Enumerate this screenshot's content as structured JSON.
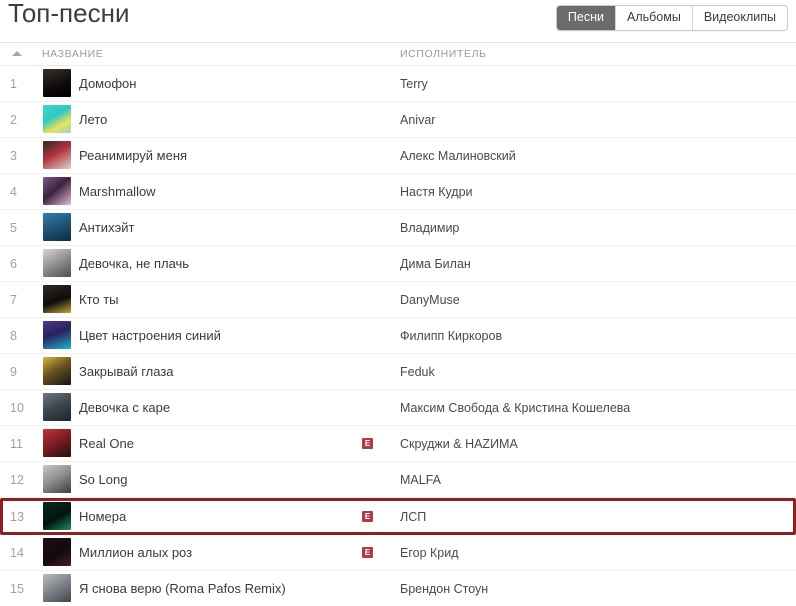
{
  "header": {
    "title": "Топ-песни",
    "tabs": [
      {
        "label": "Песни",
        "active": true
      },
      {
        "label": "Альбомы",
        "active": false
      },
      {
        "label": "Видеоклипы",
        "active": false
      }
    ]
  },
  "columns": {
    "sort_icon": "sort-ascending-triangle",
    "title": "НАЗВАНИЕ",
    "artist": "ИСПОЛНИТЕЛЬ"
  },
  "colors": {
    "accent_active_tab": "#6b6b6b",
    "explicit_badge": "#b23b4b",
    "highlight_border": "#8e2020",
    "title_text": "#3d3d3d",
    "muted_text": "#9a9a9a"
  },
  "explicit_badge_label": "E",
  "tracks": [
    {
      "rank": "1",
      "title": "Домофон",
      "artist": "Terry",
      "explicit": false,
      "highlighted": false,
      "art": "linear-gradient(160deg,#3a2e24 0%,#0d0b0a 60%,#000 100%)"
    },
    {
      "rank": "2",
      "title": "Лето",
      "artist": "Anivar",
      "explicit": false,
      "highlighted": false,
      "art": "linear-gradient(150deg,#3ad7d0 0%,#2fc9c2 40%,#e8e35c 70%,#9ad3cf 100%)"
    },
    {
      "rank": "3",
      "title": "Реанимируй меня",
      "artist": "Алекс Малиновский",
      "explicit": false,
      "highlighted": false,
      "art": "linear-gradient(150deg,#2a2a2a 0%,#b4323a 45%,#d9d6d2 100%)"
    },
    {
      "rank": "4",
      "title": "Marshmallow",
      "artist": "Настя Кудри",
      "explicit": false,
      "highlighted": false,
      "art": "linear-gradient(140deg,#7c5a86 0%,#3b2440 45%,#e8b9d4 100%)"
    },
    {
      "rank": "5",
      "title": "Антихэйт",
      "artist": "Владимир",
      "explicit": false,
      "highlighted": false,
      "art": "linear-gradient(160deg,#2e7fae 0%,#1d4f70 55%,#0f2c42 100%)"
    },
    {
      "rank": "6",
      "title": "Девочка, не плачь",
      "artist": "Дима Билан",
      "explicit": false,
      "highlighted": false,
      "art": "linear-gradient(150deg,#d6d6d6 0%,#8f8f90 50%,#4a4a52 100%)"
    },
    {
      "rank": "7",
      "title": "Кто ты",
      "artist": "DanyMuse",
      "explicit": false,
      "highlighted": false,
      "art": "linear-gradient(160deg,#2b2a26 0%,#0e0d0c 55%,#c8a23a 100%)"
    },
    {
      "rank": "8",
      "title": "Цвет настроения синий",
      "artist": "Филипп Киркоров",
      "explicit": false,
      "highlighted": false,
      "art": "linear-gradient(160deg,#4b3a86 0%,#2b2060 45%,#19b6c9 100%)"
    },
    {
      "rank": "9",
      "title": "Закрывай глаза",
      "artist": "Feduk",
      "explicit": false,
      "highlighted": false,
      "art": "linear-gradient(150deg,#e0b33c 0%,#6b5520 45%,#141210 100%)"
    },
    {
      "rank": "10",
      "title": "Девочка с каре",
      "artist": "Максим Свобода & Кристина Кошелева",
      "explicit": false,
      "highlighted": false,
      "art": "linear-gradient(155deg,#6d7b84 0%,#3f4a52 45%,#1d2227 100%)"
    },
    {
      "rank": "11",
      "title": "Real One",
      "artist": "Скруджи & HAZИMA",
      "explicit": true,
      "highlighted": false,
      "art": "linear-gradient(150deg,#c2343b 0%,#7a1b22 50%,#20100f 100%)"
    },
    {
      "rank": "12",
      "title": "So Long",
      "artist": "MALFA",
      "explicit": false,
      "highlighted": false,
      "art": "linear-gradient(150deg,#c9c9c9 0%,#8b8b8b 50%,#3c3c3c 100%)"
    },
    {
      "rank": "13",
      "title": "Номера",
      "artist": "ЛСП",
      "explicit": true,
      "highlighted": true,
      "art": "linear-gradient(150deg,#062a1c 0%,#03140e 55%,#1e8f5e 100%)"
    },
    {
      "rank": "14",
      "title": "Миллион алых роз",
      "artist": "Егор Крид",
      "explicit": true,
      "highlighted": false,
      "art": "linear-gradient(150deg,#1b1012 0%,#120a0c 55%,#4a1b22 100%)"
    },
    {
      "rank": "15",
      "title": "Я снова верю (Roma Pafos Remix)",
      "artist": "Брендон Стоун",
      "explicit": false,
      "highlighted": false,
      "art": "linear-gradient(150deg,#b9bcc0 0%,#7e8288 50%,#41454a 100%)"
    }
  ]
}
